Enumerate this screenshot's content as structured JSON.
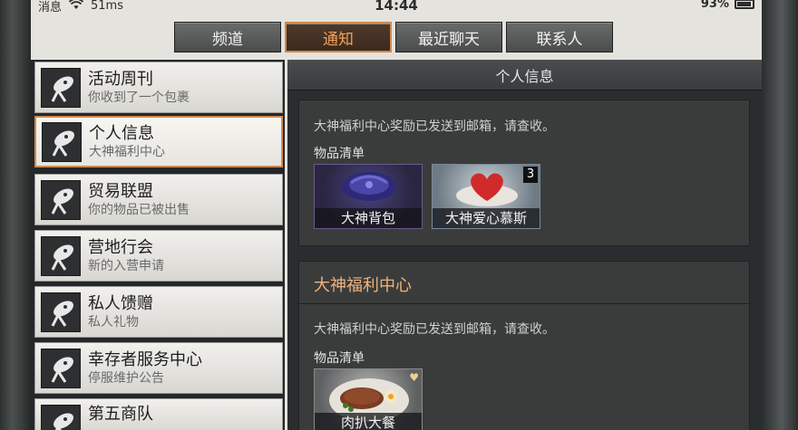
{
  "status": {
    "carrier": "消息",
    "speed": "51ms",
    "time": "14:44",
    "battery": "93%"
  },
  "tabs": [
    {
      "label": "频道",
      "active": false
    },
    {
      "label": "通知",
      "active": true
    },
    {
      "label": "最近聊天",
      "active": false
    },
    {
      "label": "联系人",
      "active": false
    }
  ],
  "sidebar": {
    "items": [
      {
        "title": "活动周刊",
        "subtitle": "你收到了一个包裹",
        "icon": "radar-dish-icon"
      },
      {
        "title": "个人信息",
        "subtitle": "大神福利中心",
        "icon": "radar-dish-icon",
        "active": true
      },
      {
        "title": "贸易联盟",
        "subtitle": "你的物品已被出售",
        "icon": "radar-dish-icon"
      },
      {
        "title": "营地行会",
        "subtitle": "新的入营申请",
        "icon": "radar-dish-icon"
      },
      {
        "title": "私人馈赠",
        "subtitle": "私人礼物",
        "icon": "radar-dish-icon"
      },
      {
        "title": "幸存者服务中心",
        "subtitle": "停服维护公告",
        "icon": "radar-dish-icon"
      },
      {
        "title": "第五商队",
        "subtitle": "",
        "icon": "radar-dish-icon"
      }
    ]
  },
  "main": {
    "header": "个人信息",
    "card1": {
      "text": "大神福利中心奖励已发送到邮箱，请查收。",
      "list_label": "物品清单",
      "items": [
        {
          "name": "大神背包",
          "count": ""
        },
        {
          "name": "大神爱心慕斯",
          "count": "3"
        }
      ]
    },
    "card2": {
      "title": "大神福利中心",
      "text": "大神福利中心奖励已发送到邮箱，请查收。",
      "list_label": "物品清单",
      "items": [
        {
          "name": "肉扒大餐",
          "count": ""
        }
      ]
    }
  },
  "colors": {
    "accent": "#d48a4c",
    "tab_active_text": "#f4a25a",
    "card_title": "#f0b27a"
  }
}
